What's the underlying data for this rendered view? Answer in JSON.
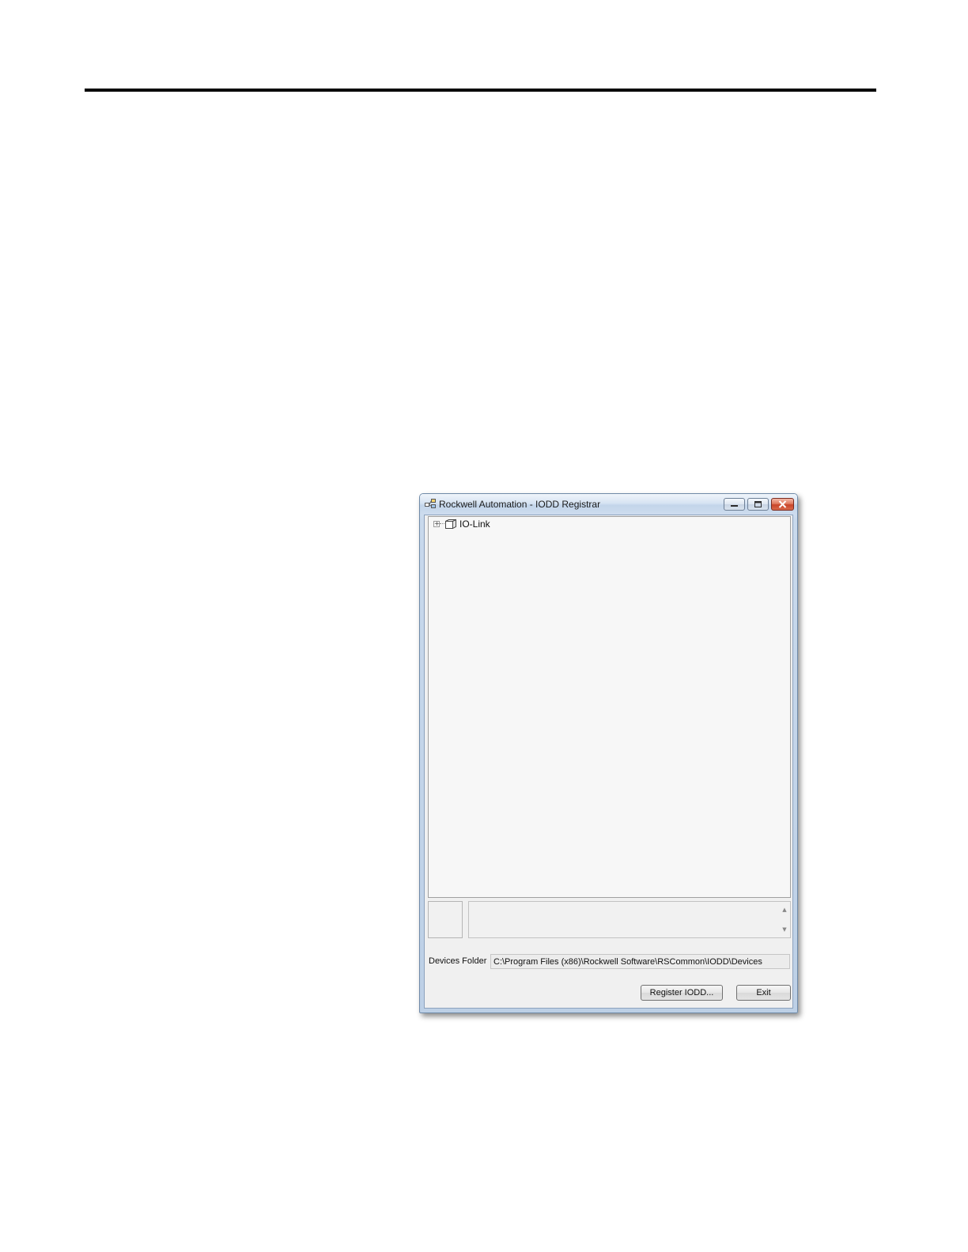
{
  "window": {
    "title": "Rockwell Automation - IODD Registrar"
  },
  "tree": {
    "items": [
      {
        "label": "IO-Link",
        "expander": "+"
      }
    ]
  },
  "devices_folder": {
    "label": "Devices Folder",
    "value": "C:\\Program Files (x86)\\Rockwell Software\\RSCommon\\IODD\\Devices"
  },
  "buttons": {
    "register": "Register IODD...",
    "exit": "Exit"
  },
  "info_panel": {
    "scroll_up": "▲",
    "scroll_down": "▼"
  }
}
